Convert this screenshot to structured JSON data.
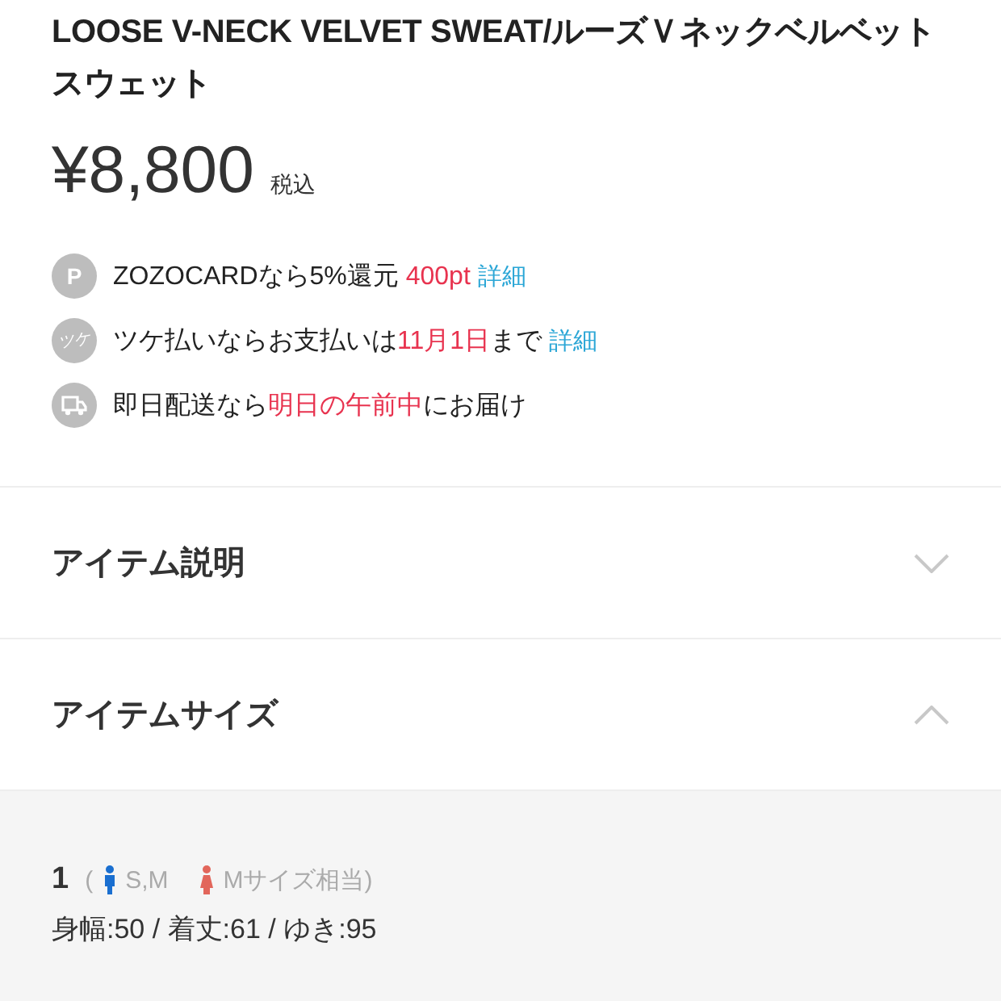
{
  "product": {
    "title": "LOOSE V-NECK VELVET SWEAT/ルーズＶネックベルベットスウェット",
    "price": "¥8,800",
    "tax_note": "税込"
  },
  "benefits": [
    {
      "kind": "points",
      "icon_label": "P",
      "segments": [
        {
          "kind": "text",
          "text": "ZOZOCARDなら5%還元 "
        },
        {
          "kind": "accent",
          "text": "400pt"
        }
      ],
      "link": "詳細"
    },
    {
      "kind": "tsuke",
      "icon_label": "ツケ",
      "segments": [
        {
          "kind": "text",
          "text": "ツケ払いならお支払いは"
        },
        {
          "kind": "accent",
          "text": "11月1日"
        },
        {
          "kind": "text",
          "text": "まで"
        }
      ],
      "link": "詳細"
    },
    {
      "kind": "truck",
      "segments": [
        {
          "kind": "text",
          "text": "即日配送なら"
        },
        {
          "kind": "accent",
          "text": "明日の午前中"
        },
        {
          "kind": "text",
          "text": "にお届け"
        }
      ]
    }
  ],
  "sections": [
    {
      "title": "アイテム説明",
      "expanded": false
    },
    {
      "title": "アイテムサイズ",
      "expanded": true
    }
  ],
  "sizes": [
    {
      "number": "1",
      "open_paren": "(",
      "mens": "S,M",
      "womens": "Mサイズ相当)",
      "measurements": "身幅:50 / 着丈:61 / ゆき:95"
    }
  ]
}
